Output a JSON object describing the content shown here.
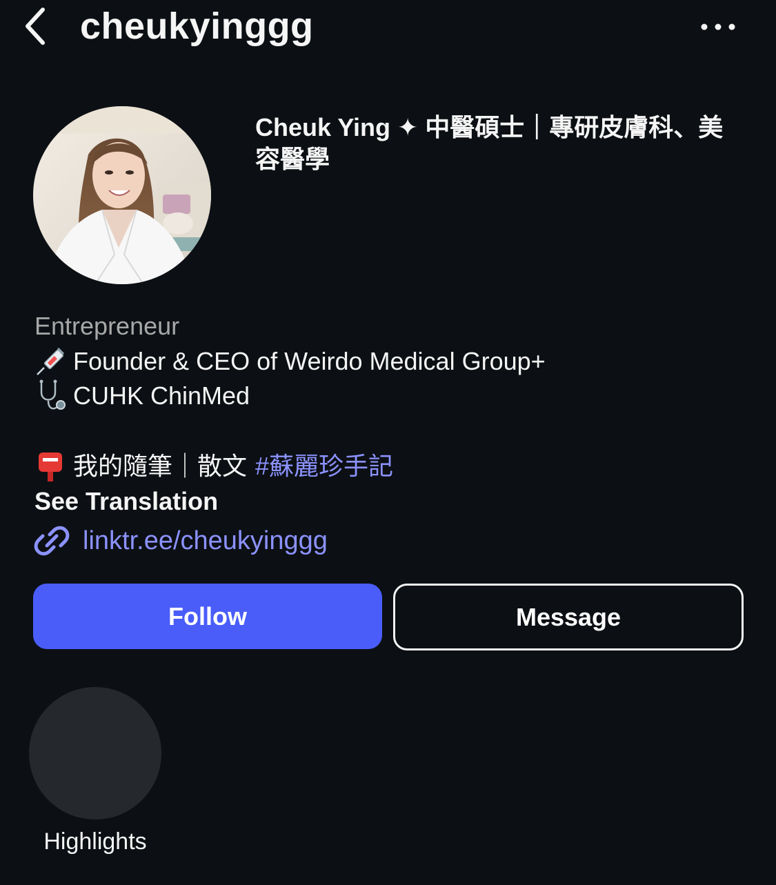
{
  "header": {
    "username": "cheukyinggg",
    "back_icon": "chevron-left-icon",
    "more_icon": "more-horizontal-icon"
  },
  "profile": {
    "display_name": "Cheuk Ying ✦ 中醫碩士｜專研皮膚科、美容醫學",
    "category": "Entrepreneur",
    "bio": [
      {
        "icon": "syringe-icon",
        "text": "Founder & CEO of Weirdo Medical Group+"
      },
      {
        "icon": "stethoscope-icon",
        "text": "CUHK ChinMed"
      },
      {
        "icon": "postbox-icon",
        "text": "我的隨筆｜散文",
        "hashtag": "#蘇麗珍手記"
      }
    ],
    "see_translation": "See Translation",
    "link": "linktr.ee/cheukyinggg"
  },
  "actions": {
    "follow": "Follow",
    "message": "Message"
  },
  "highlights": [
    {
      "label": "Highlights"
    }
  ],
  "colors": {
    "background": "#0c1014",
    "follow_button": "#4a5df9",
    "link": "#8c92ff",
    "secondary_text": "#a8a8a8",
    "highlight_circle": "#25282d"
  }
}
